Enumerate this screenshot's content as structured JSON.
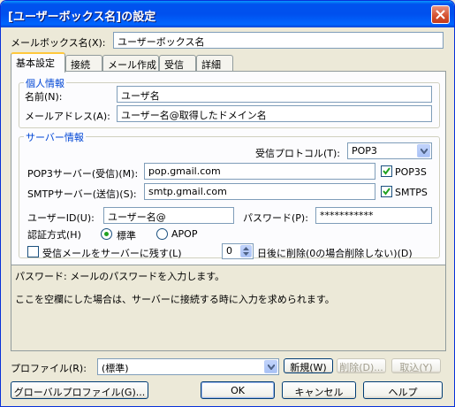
{
  "window": {
    "title": "[ユーザーボックス名]の設定"
  },
  "mailbox": {
    "label": "メールボックス名(X):",
    "value": "ユーザーボックス名"
  },
  "tabs": [
    {
      "label": "基本設定"
    },
    {
      "label": "接続"
    },
    {
      "label": "メール作成"
    },
    {
      "label": "受信"
    },
    {
      "label": "詳細"
    }
  ],
  "personal": {
    "title": "個人情報",
    "name_label": "名前(N):",
    "name_value": "ユーザ名",
    "email_label": "メールアドレス(A):",
    "email_value": "ユーザー名@取得したドメイン名"
  },
  "server": {
    "title": "サーバー情報",
    "protocol_label": "受信プロトコル(T):",
    "protocol_value": "POP3",
    "pop3_label": "POP3サーバー(受信)(M):",
    "pop3_value": "pop.gmail.com",
    "pop3s_label": "POP3S",
    "smtp_label": "SMTPサーバー(送信)(S):",
    "smtp_value": "smtp.gmail.com",
    "smtps_label": "SMTPS",
    "userid_label": "ユーザーID(U):",
    "userid_value": "ユーザー名@",
    "password_label": "パスワード(P):",
    "password_value": "***********",
    "auth_label": "認証方式(H)",
    "auth_standard": "標準",
    "auth_apop": "APOP",
    "leave_label": "受信メールをサーバーに残す(L)",
    "days_value": "0",
    "delete_after_label": "日後に削除(0の場合削除しない)(D)"
  },
  "help": {
    "line1": "パスワード: メールのパスワードを入力します。",
    "line2": "ここを空欄にした場合は、サーバーに接続する時に入力を求められます。"
  },
  "profile": {
    "label": "プロファイル(R):",
    "value": "(標準)",
    "new_label": "新規(W)",
    "delete_label": "削除(D)...",
    "cancel_label": "取込(Y)"
  },
  "footer": {
    "global_profile_label": "グローバルプロファイル(G)...",
    "ok_label": "OK",
    "cancel_label": "キャンセル",
    "help_label": "ヘルプ"
  },
  "colors": {
    "title_blue": "#0050ee",
    "group_title": "#0046d5",
    "check_green": "#21a121"
  }
}
